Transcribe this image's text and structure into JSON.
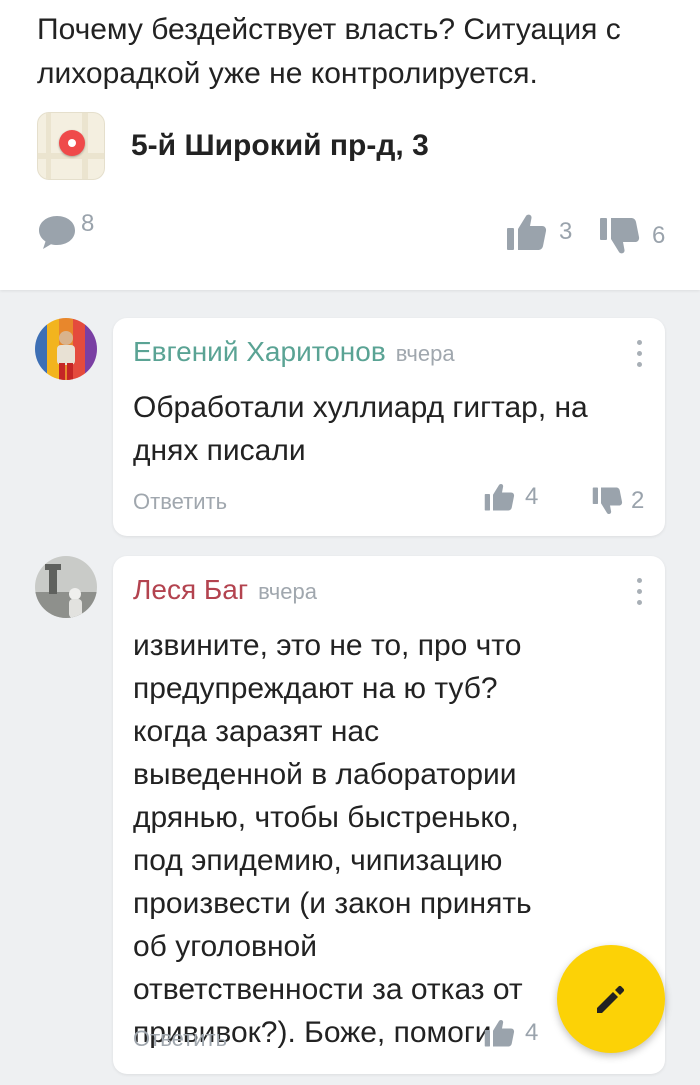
{
  "post": {
    "text": "Почему бездействует власть? Ситуация с лихорадкой уже не контролируется.",
    "place": {
      "label": "5-й Широкий пр-д, 3",
      "icon": "map-pin-icon"
    },
    "comments_count": "8",
    "likes": "3",
    "dislikes": "6"
  },
  "comments": [
    {
      "author": "Евгений Харитонов",
      "author_color": "#5aa394",
      "time": "вчера",
      "text": "Обработали хуллиард гигтар, на днях писали",
      "reply_label": "Ответить",
      "likes": "4",
      "dislikes": "2"
    },
    {
      "author": "Леся Баг",
      "author_color": "#b3434f",
      "time": "вчера",
      "text": "извините, это не то, про что предупреждают на ю туб? когда заразят нас выведенной в лаборатории дрянью, чтобы быстренько, под эпидемию, чипизацию произвести (и закон принять об уголовной ответственности за отказ от прививок?). Боже, помоги.",
      "reply_label": "Ответить",
      "likes": "4"
    }
  ],
  "colors": {
    "accent_fab": "#fcd206",
    "muted": "#9aa3ac",
    "background": "#eef0f2"
  },
  "fab": {
    "icon": "pencil-icon"
  }
}
